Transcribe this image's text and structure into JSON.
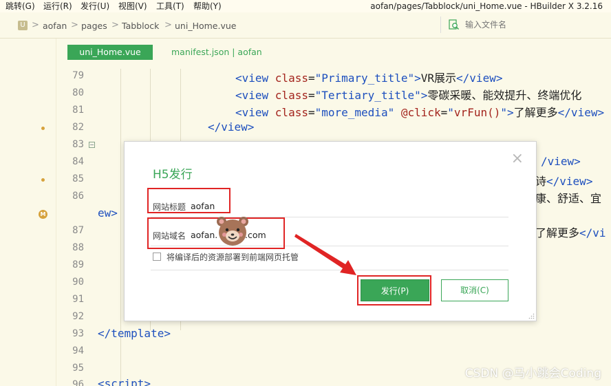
{
  "menu": {
    "items": [
      "跳转(G)",
      "运行(R)",
      "发行(U)",
      "视图(V)",
      "工具(T)",
      "帮助(Y)"
    ],
    "window_title": "aofan/pages/Tabblock/uni_Home.vue - HBuilder X 3.2.16"
  },
  "breadcrumb": {
    "badge": "U",
    "items": [
      "aofan",
      "pages",
      "Tabblock",
      "uni_Home.vue"
    ],
    "separator": ">",
    "search_placeholder": "输入文件名"
  },
  "tabs": {
    "active": "uni_Home.vue",
    "inactive": "manifest.json | aofan"
  },
  "line_numbers": [
    "79",
    "80",
    "81",
    "82",
    "83",
    "84",
    "85",
    "86",
    "87",
    "88",
    "89",
    "90",
    "91",
    "92",
    "93",
    "94",
    "95",
    "96"
  ],
  "code": {
    "l79": {
      "t1": "<view ",
      "a1": "class",
      "e1": "=",
      "s1": "\"Primary_title\"",
      "t2": ">",
      "x1": "VR展示",
      "t3": "</view>"
    },
    "l80": {
      "t1": "<view ",
      "a1": "class",
      "e1": "=",
      "s1": "\"Tertiary_title\"",
      "t2": ">",
      "x1": "零碳采暖、能效提升、终端优化"
    },
    "l81": {
      "t1": "<view ",
      "a1": "class",
      "e1": "=",
      "s1": "\"more_media\"",
      "a2": " @click",
      "e2": "=",
      "s2": "\"",
      "f1": "vrFun()",
      "s3": "\"",
      "t2": ">",
      "x1": "了解更多",
      "t3": "</view>"
    },
    "l82": {
      "t1": "</view>"
    },
    "l84": {
      "t1": "/view>"
    },
    "l85": {
      "x1": "诗",
      "t1": "</view>"
    },
    "l86": {
      "x1": "康、舒适、宜"
    },
    "l86b": {
      "t1": "ew>"
    },
    "l87": {
      "x1": "了解更多",
      "t1": "</vi"
    },
    "l93": {
      "t1": "</template>"
    },
    "l96": {
      "t1": "<script>"
    }
  },
  "dialog": {
    "title": "H5发行",
    "close": "×",
    "site_title_label": "网站标题",
    "site_title_value": "aofan",
    "site_domain_label": "网站域名",
    "site_domain_value": "aofan.        n.com",
    "deploy_checkbox_label": "将编译后的资源部署到前端网页托管",
    "publish_button": "发行(P)",
    "cancel_button": "取消(C)"
  },
  "watermark": "CSDN @马小跳会Coding",
  "colors": {
    "accent_green": "#3aa657",
    "highlight_red": "#e02424",
    "tag_blue": "#1d4fbe",
    "attr_red": "#a3241d",
    "editor_bg": "#fbf9e8"
  }
}
